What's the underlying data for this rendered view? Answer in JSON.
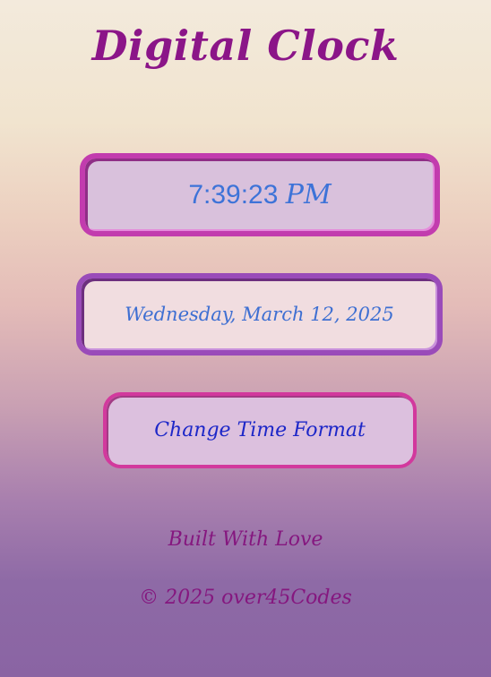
{
  "header": {
    "title": "Digital Clock"
  },
  "clock": {
    "time": "7:39:23",
    "period": "PM",
    "date": "Wednesday, March 12, 2025"
  },
  "actions": {
    "change_format_label": "Change Time Format"
  },
  "footer": {
    "built_text": "Built With Love",
    "copyright": "© 2025 over45Codes"
  },
  "colors": {
    "title": "#8b1588",
    "time_text": "#3d73d8",
    "date_text": "#3e6fd2",
    "button_text": "#1d27c8",
    "footer_text": "#85177f",
    "time_border": "#c23cae",
    "date_border": "#9a4bb9",
    "button_border": "#d2399d"
  }
}
